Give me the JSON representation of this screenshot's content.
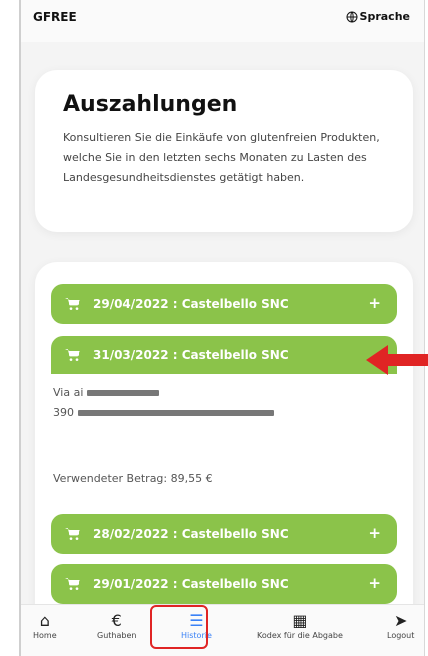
{
  "header": {
    "brand": "GFREE",
    "language_label": "Sprache"
  },
  "intro": {
    "title": "Auszahlungen",
    "text": "Konsultieren Sie die Einkäufe von glutenfreien Produkten, welche Sie in den letzten sechs Monaten zu Lasten des Landesgesundheitsdienstes getätigt haben."
  },
  "purchases": [
    {
      "label": "29/04/2022 : Castelbello SNC",
      "expanded": false
    },
    {
      "label": "31/03/2022 : Castelbello SNC",
      "expanded": true
    },
    {
      "label": "28/02/2022 : Castelbello SNC",
      "expanded": false
    },
    {
      "label": "29/01/2022 : Castelbello SNC",
      "expanded": false
    }
  ],
  "detail": {
    "address_prefix": "Via ai",
    "postal_prefix": "390",
    "amount": "Verwendeter Betrag: 89,55 €"
  },
  "nav": {
    "items": [
      {
        "label": "Home",
        "icon": "home-icon"
      },
      {
        "label": "Guthaben",
        "icon": "euro-icon"
      },
      {
        "label": "Historie",
        "icon": "list-icon"
      },
      {
        "label": "Kodex für die Abgabe",
        "icon": "qr-code-icon"
      },
      {
        "label": "Logout",
        "icon": "logout-icon"
      }
    ],
    "active": "Historie"
  },
  "colors": {
    "pill": "#8bc34a",
    "active": "#3b82f6",
    "annotation": "#e02424"
  }
}
